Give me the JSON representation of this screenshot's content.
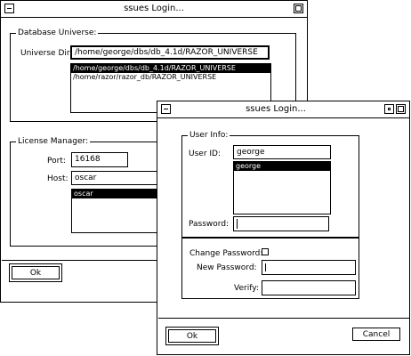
{
  "back_window": {
    "title": "ssues Login...",
    "database_universe": {
      "group_label": "Database Universe:",
      "universe_dir_label": "Universe Dir:",
      "universe_dir_value": "/home/george/dbs/db_4.1d/RAZOR_UNIVERSE",
      "list_items": [
        "/home/george/dbs/db_4.1d/RAZOR_UNIVERSE",
        "/home/razor/razor_db/RAZOR_UNIVERSE"
      ],
      "selected_index": 0
    },
    "license_manager": {
      "group_label": "License Manager:",
      "port_label": "Port:",
      "port_value": "16168",
      "host_label": "Host:",
      "host_value": "oscar",
      "host_list": [
        "oscar"
      ],
      "selected_index": 0
    },
    "ok_label": "Ok"
  },
  "front_window": {
    "title": "ssues Login...",
    "user_info": {
      "group_label": "User Info:",
      "user_id_label": "User ID:",
      "user_id_value": "george",
      "user_list": [
        "george"
      ],
      "selected_index": 0,
      "password_label": "Password:",
      "password_value": ""
    },
    "change_password": {
      "change_password_label": "Change Password:",
      "new_password_label": "New Password:",
      "new_password_value": "",
      "verify_label": "Verify:",
      "verify_value": ""
    },
    "ok_label": "Ok",
    "cancel_label": "Cancel"
  }
}
